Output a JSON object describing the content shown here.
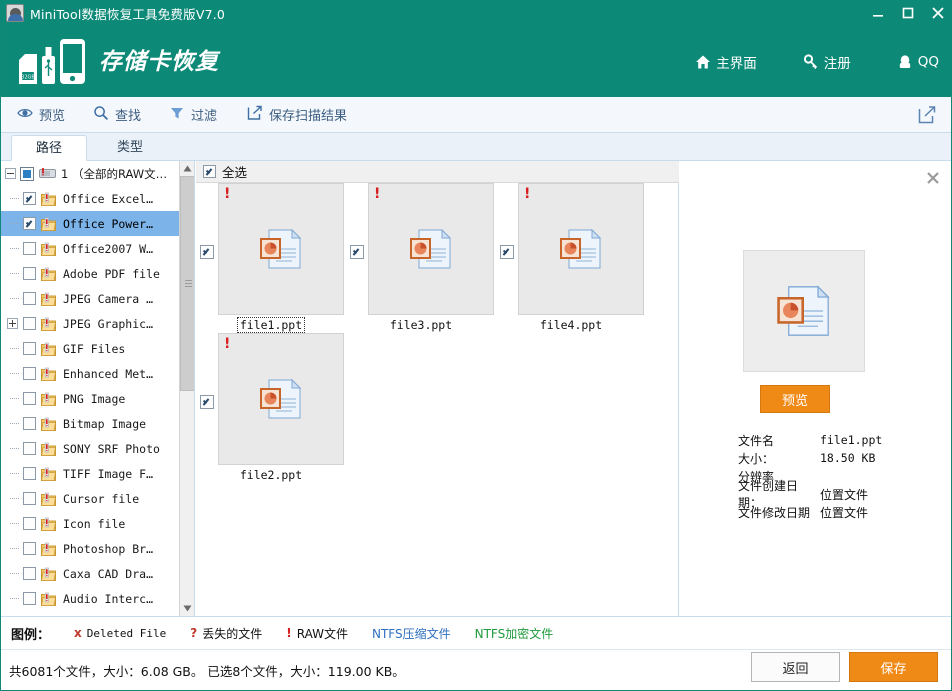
{
  "window": {
    "title": "MiniTool数据恢复工具免费版V7.0",
    "icon": "app-icon",
    "controls": {
      "minimize": "–",
      "maximize": "□",
      "close": "✕"
    }
  },
  "brand": {
    "title": "存储卡恢复",
    "accent": "#0d8a77",
    "nav": [
      {
        "label": "主界面",
        "icon": "home-icon"
      },
      {
        "label": "注册",
        "icon": "key-icon"
      },
      {
        "label": "QQ",
        "icon": "qq-penguin-icon"
      }
    ]
  },
  "toolbar": {
    "items": [
      {
        "label": "预览",
        "icon": "eye-icon"
      },
      {
        "label": "查找",
        "icon": "search-icon"
      },
      {
        "label": "过滤",
        "icon": "funnel-icon"
      },
      {
        "label": "保存扫描结果",
        "icon": "export-icon"
      }
    ],
    "share_icon": "share-export-icon"
  },
  "tabs": [
    {
      "label": "路径",
      "active": true
    },
    {
      "label": "类型",
      "active": false
    }
  ],
  "tree": {
    "root": {
      "label": "1 （全部的RAW文…",
      "expander": "minus",
      "checkbox": "tristate"
    },
    "items": [
      {
        "label": "Office Excel…",
        "checked": true,
        "expander": "none",
        "selected": false
      },
      {
        "label": "Office Power…",
        "checked": true,
        "expander": "none",
        "selected": true
      },
      {
        "label": "Office2007 W…",
        "checked": false,
        "expander": "none",
        "selected": false
      },
      {
        "label": "Adobe PDF file",
        "checked": false,
        "expander": "none",
        "selected": false
      },
      {
        "label": "JPEG Camera …",
        "checked": false,
        "expander": "none",
        "selected": false
      },
      {
        "label": "JPEG Graphic…",
        "checked": false,
        "expander": "plus",
        "selected": false
      },
      {
        "label": "GIF Files",
        "checked": false,
        "expander": "none",
        "selected": false
      },
      {
        "label": "Enhanced Met…",
        "checked": false,
        "expander": "none",
        "selected": false
      },
      {
        "label": "PNG Image",
        "checked": false,
        "expander": "none",
        "selected": false
      },
      {
        "label": "Bitmap Image",
        "checked": false,
        "expander": "none",
        "selected": false
      },
      {
        "label": "SONY SRF Photo",
        "checked": false,
        "expander": "none",
        "selected": false
      },
      {
        "label": "TIFF Image F…",
        "checked": false,
        "expander": "none",
        "selected": false
      },
      {
        "label": "Cursor file",
        "checked": false,
        "expander": "none",
        "selected": false
      },
      {
        "label": "Icon file",
        "checked": false,
        "expander": "none",
        "selected": false
      },
      {
        "label": "Photoshop Br…",
        "checked": false,
        "expander": "none",
        "selected": false
      },
      {
        "label": "Caxa CAD Dra…",
        "checked": false,
        "expander": "none",
        "selected": false
      },
      {
        "label": "Audio Interc…",
        "checked": false,
        "expander": "none",
        "selected": false
      }
    ]
  },
  "files": {
    "select_all_label": "全选",
    "select_all_checked": true,
    "items": [
      {
        "name": "file1.ppt",
        "checked": true,
        "flag": "!",
        "focused": true
      },
      {
        "name": "file3.ppt",
        "checked": true,
        "flag": "!",
        "focused": false
      },
      {
        "name": "file4.ppt",
        "checked": true,
        "flag": "!",
        "focused": false
      },
      {
        "name": "file2.ppt",
        "checked": true,
        "flag": "!",
        "focused": false
      }
    ]
  },
  "preview": {
    "close_icon": "close-icon",
    "button_label": "预览",
    "button_color": "#f08a17",
    "meta": [
      {
        "key": "文件名",
        "value": "file1.ppt",
        "mono": true
      },
      {
        "key": "大小：",
        "value": "18.50 KB",
        "mono": true
      },
      {
        "key": "分辨率",
        "value": "",
        "mono": true
      },
      {
        "key": "文件创建日期：",
        "value": "位置文件",
        "mono": false
      },
      {
        "key": "文件修改日期",
        "value": "位置文件",
        "mono": false
      }
    ]
  },
  "legend": {
    "title": "图例：",
    "items": [
      {
        "mark": "x",
        "mark_color": "#c0392b",
        "label": "Deleted File",
        "label_color": "#111111",
        "cn": false
      },
      {
        "mark": "?",
        "mark_color": "#c0392b",
        "label": "丢失的文件",
        "label_color": "#111111",
        "cn": true
      },
      {
        "mark": "!",
        "mark_color": "#d81f1f",
        "label": "RAW文件",
        "label_color": "#111111",
        "cn": true
      },
      {
        "mark": "",
        "mark_color": "#2f6fc0",
        "label": "NTFS压缩文件",
        "label_color": "#2f6fc0",
        "cn": true
      },
      {
        "mark": "",
        "mark_color": "#1f9a3c",
        "label": "NTFS加密文件",
        "label_color": "#1f9a3c",
        "cn": true
      }
    ]
  },
  "status": {
    "text": "共6081个文件，大小：6.08 GB。 已选8个文件，大小：119.00 KB。",
    "total_files": 6081,
    "total_size": "6.08 GB",
    "selected_files": 8,
    "selected_size": "119.00 KB"
  },
  "actions": {
    "back_label": "返回",
    "save_label": "保存"
  }
}
